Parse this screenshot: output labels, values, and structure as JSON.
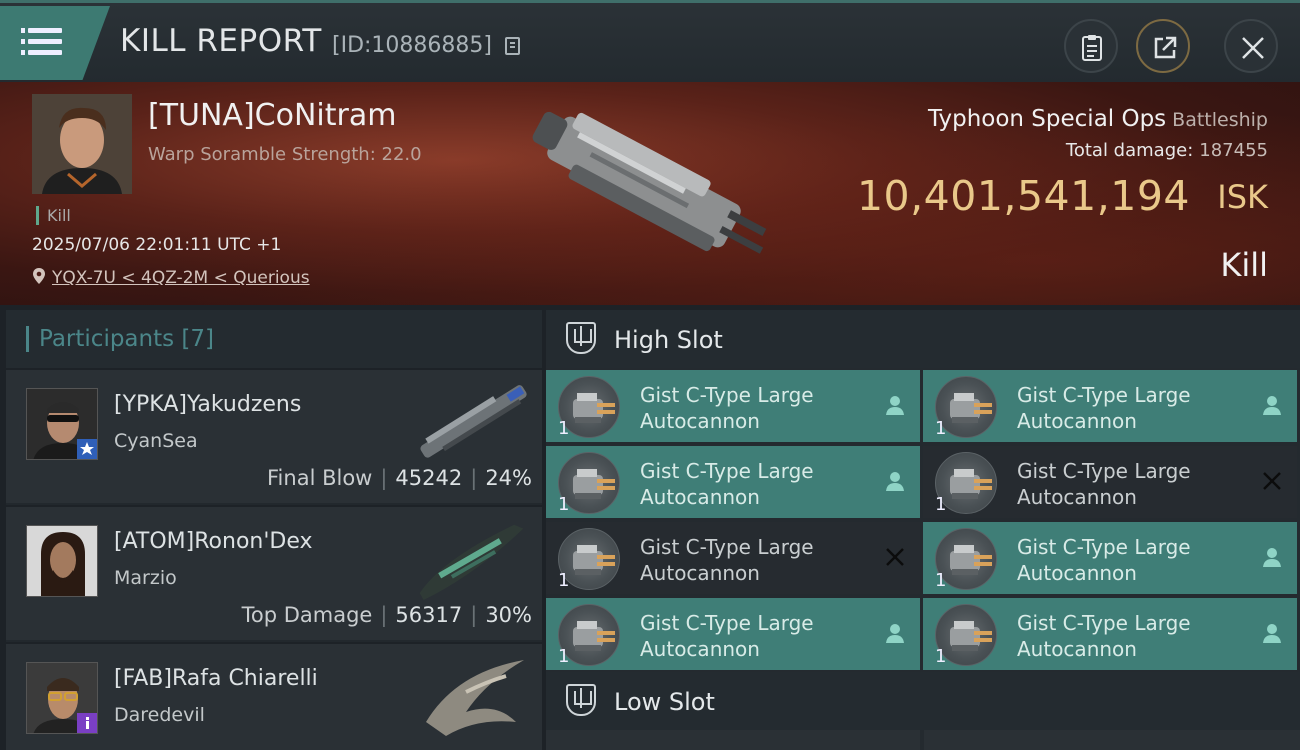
{
  "header": {
    "title": "KILL REPORT",
    "kill_id": "[ID:10886885]"
  },
  "victim": {
    "pilot_name": "[TUNA]CoNitram",
    "scramble_label": "Warp Soramble Strength: 22.0",
    "kill_tag": "Kill",
    "datetime": "2025/07/06 22:01:11 UTC +1",
    "location": "YQX-7U < 4QZ-2M < Querious",
    "ship_name": "Typhoon Special Ops",
    "ship_class": "Battleship",
    "total_damage_label": "Total damage:",
    "total_damage": "187455",
    "isk_value": "10,401,541,194",
    "isk_unit": "ISK",
    "result": "Kill"
  },
  "participants": {
    "title": "Participants [7]",
    "rows": [
      {
        "name": "[YPKA]Yakudzens",
        "ship": "CyanSea",
        "stat_label": "Final Blow",
        "damage": "45242",
        "percent": "24%",
        "badge": "star"
      },
      {
        "name": "[ATOM]Ronon'Dex",
        "ship": "Marzio",
        "stat_label": "Top Damage",
        "damage": "56317",
        "percent": "30%",
        "badge": ""
      },
      {
        "name": "[FAB]Rafa Chiarelli",
        "ship": "Daredevil",
        "stat_label": "",
        "damage": "",
        "percent": "",
        "badge": "info"
      }
    ]
  },
  "high_slot": {
    "label": "High Slot",
    "modules": [
      {
        "line1": "Gist C-Type Large",
        "line2": "Autocannon",
        "qty": "1",
        "state": "on"
      },
      {
        "line1": "Gist C-Type Large",
        "line2": "Autocannon",
        "qty": "1",
        "state": "on"
      },
      {
        "line1": "Gist C-Type Large",
        "line2": "Autocannon",
        "qty": "1",
        "state": "on"
      },
      {
        "line1": "Gist C-Type Large",
        "line2": "Autocannon",
        "qty": "1",
        "state": "off"
      },
      {
        "line1": "Gist C-Type Large",
        "line2": "Autocannon",
        "qty": "1",
        "state": "off"
      },
      {
        "line1": "Gist C-Type Large",
        "line2": "Autocannon",
        "qty": "1",
        "state": "on"
      },
      {
        "line1": "Gist C-Type Large",
        "line2": "Autocannon",
        "qty": "1",
        "state": "on"
      },
      {
        "line1": "Gist C-Type Large",
        "line2": "Autocannon",
        "qty": "1",
        "state": "on"
      }
    ]
  },
  "low_slot": {
    "label": "Low Slot"
  },
  "colors": {
    "accent_teal": "#3f7e77",
    "isk_gold": "#e9c88a",
    "participants_title": "#4b8689"
  },
  "icons": {
    "menu": "menu-icon",
    "copy": "copy-icon",
    "clipboard": "clipboard-icon",
    "share": "share-icon",
    "close": "close-icon",
    "location": "location-pin-icon",
    "slot": "slot-icon",
    "dropped": "person-icon",
    "destroyed": "x-icon"
  }
}
